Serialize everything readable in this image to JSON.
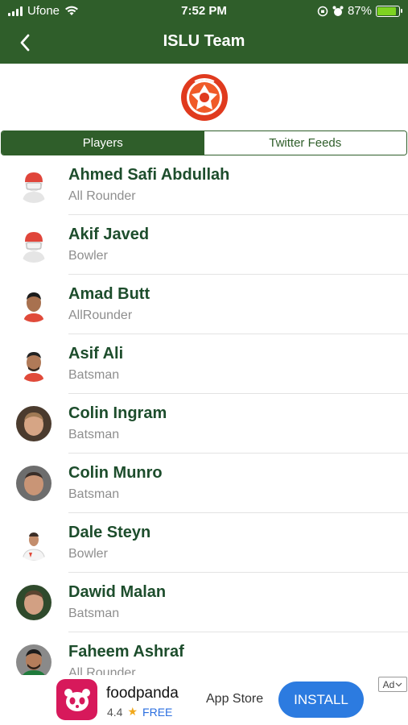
{
  "status_bar": {
    "carrier": "Ufone",
    "time": "7:52 PM",
    "battery": "87%",
    "battery_level": 0.87
  },
  "nav": {
    "title": "ISLU Team"
  },
  "tabs": [
    {
      "label": "Players",
      "active": true
    },
    {
      "label": "Twitter Feeds",
      "active": false
    }
  ],
  "players": [
    {
      "name": "Ahmed Safi Abdullah",
      "role": "All Rounder",
      "avatar": "placeholder-player-icon"
    },
    {
      "name": "Akif Javed",
      "role": "Bowler",
      "avatar": "placeholder-player-icon"
    },
    {
      "name": "Amad Butt",
      "role": "AllRounder",
      "avatar": "player-photo"
    },
    {
      "name": "Asif Ali",
      "role": "Batsman",
      "avatar": "player-photo"
    },
    {
      "name": "Colin Ingram",
      "role": "Batsman",
      "avatar": "player-photo"
    },
    {
      "name": "Colin Munro",
      "role": "Batsman",
      "avatar": "player-photo"
    },
    {
      "name": "Dale Steyn",
      "role": "Bowler",
      "avatar": "player-photo"
    },
    {
      "name": "Dawid Malan",
      "role": "Batsman",
      "avatar": "player-photo"
    },
    {
      "name": "Faheem Ashraf",
      "role": "All Rounder",
      "avatar": "player-photo"
    }
  ],
  "ad": {
    "name": "foodpanda",
    "rating": "4.4",
    "star": "★",
    "price": "FREE",
    "store": "App Store",
    "install": "INSTALL",
    "badge": "Ad"
  },
  "colors": {
    "header_green": "#2f5e2a",
    "name_green": "#1d4d2c",
    "role_gray": "#8e8e8e",
    "install_blue": "#2c7be0",
    "foodpanda_pink": "#d7195b"
  }
}
